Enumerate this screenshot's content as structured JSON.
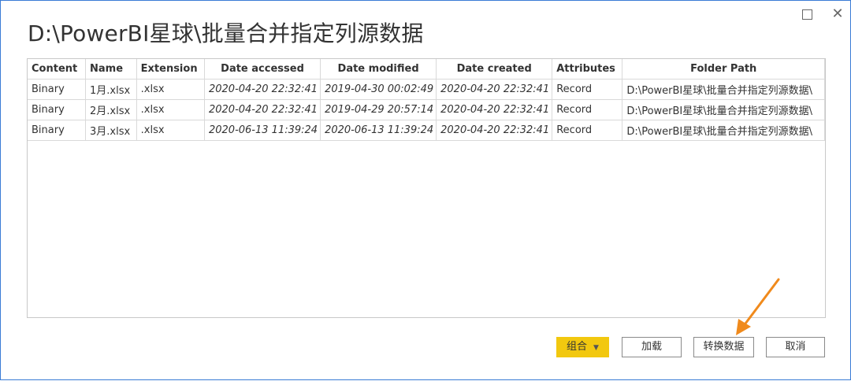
{
  "window": {
    "title": "D:\\PowerBI星球\\批量合并指定列源数据",
    "maximize_icon": "maximize-icon",
    "close_icon": "close-icon",
    "close_glyph": "✕"
  },
  "table": {
    "columns": [
      "Content",
      "Name",
      "Extension",
      "Date accessed",
      "Date modified",
      "Date created",
      "Attributes",
      "Folder Path"
    ],
    "rows": [
      [
        "Binary",
        "1月.xlsx",
        ".xlsx",
        "2020-04-20 22:32:41",
        "2019-04-30 00:02:49",
        "2020-04-20 22:32:41",
        "Record",
        "D:\\PowerBI星球\\批量合并指定列源数据\\"
      ],
      [
        "Binary",
        "2月.xlsx",
        ".xlsx",
        "2020-04-20 22:32:41",
        "2019-04-29 20:57:14",
        "2020-04-20 22:32:41",
        "Record",
        "D:\\PowerBI星球\\批量合并指定列源数据\\"
      ],
      [
        "Binary",
        "3月.xlsx",
        ".xlsx",
        "2020-06-13 11:39:24",
        "2020-06-13 11:39:24",
        "2020-04-20 22:32:41",
        "Record",
        "D:\\PowerBI星球\\批量合并指定列源数据\\"
      ]
    ]
  },
  "footer": {
    "combine_label": "组合",
    "combine_caret": "▼",
    "load_label": "加载",
    "transform_label": "转换数据",
    "cancel_label": "取消"
  },
  "annotation": {
    "arrow_color": "#f08a1c",
    "points_to": "transform-data-button"
  },
  "colors": {
    "accent": "#f2c80f",
    "border": "#3a7bd5"
  }
}
